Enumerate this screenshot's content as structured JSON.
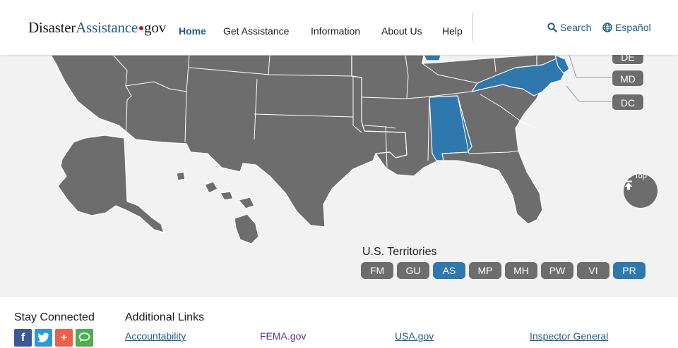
{
  "header": {
    "logo": {
      "part1": "Disaster",
      "part2": "Assistance",
      "part3": "gov"
    },
    "nav": [
      {
        "label": "Home"
      },
      {
        "label": "Get Assistance"
      },
      {
        "label": "Information"
      },
      {
        "label": "About Us"
      },
      {
        "label": "Help"
      }
    ],
    "search_label": "Search",
    "language_label": "Español"
  },
  "map": {
    "state_buttons": [
      {
        "label": "DE"
      },
      {
        "label": "MD"
      },
      {
        "label": "DC"
      }
    ],
    "top_button_label": "Top",
    "territories_title": "U.S. Territories",
    "territories": [
      {
        "label": "FM",
        "selected": false
      },
      {
        "label": "GU",
        "selected": false
      },
      {
        "label": "AS",
        "selected": true
      },
      {
        "label": "MP",
        "selected": false
      },
      {
        "label": "MH",
        "selected": false
      },
      {
        "label": "PW",
        "selected": false
      },
      {
        "label": "VI",
        "selected": false
      },
      {
        "label": "PR",
        "selected": true
      }
    ],
    "colors": {
      "state": "#6d6d6d",
      "declared": "#2e78ad",
      "background": "#f2f2f2"
    }
  },
  "footer": {
    "stay_connected": "Stay Connected",
    "additional_links": "Additional Links",
    "social": [
      "facebook",
      "twitter",
      "add",
      "chat"
    ],
    "links": [
      {
        "label": "Accountability"
      },
      {
        "label": "FEMA.gov"
      },
      {
        "label": "USA.gov"
      },
      {
        "label": "Inspector General"
      }
    ]
  }
}
